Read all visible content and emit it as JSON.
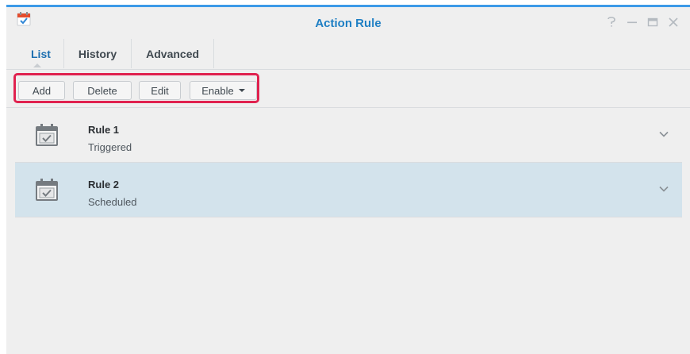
{
  "window": {
    "title": "Action Rule",
    "controls": [
      "help-icon",
      "minimize-icon",
      "maximize-icon",
      "close-icon"
    ]
  },
  "tabs": [
    {
      "label": "List",
      "active": true
    },
    {
      "label": "History",
      "active": false
    },
    {
      "label": "Advanced",
      "active": false
    }
  ],
  "toolbar": {
    "add_label": "Add",
    "delete_label": "Delete",
    "edit_label": "Edit",
    "enable_label": "Enable"
  },
  "rules": [
    {
      "name": "Rule 1",
      "status": "Triggered",
      "icon": "calendar-check-icon",
      "selected": false
    },
    {
      "name": "Rule 2",
      "status": "Scheduled",
      "icon": "calendar-check-icon",
      "selected": true
    }
  ],
  "colors": {
    "accent": "#1e7fc4",
    "highlight": "#e0224f",
    "selected_row": "#d3e3ec"
  }
}
